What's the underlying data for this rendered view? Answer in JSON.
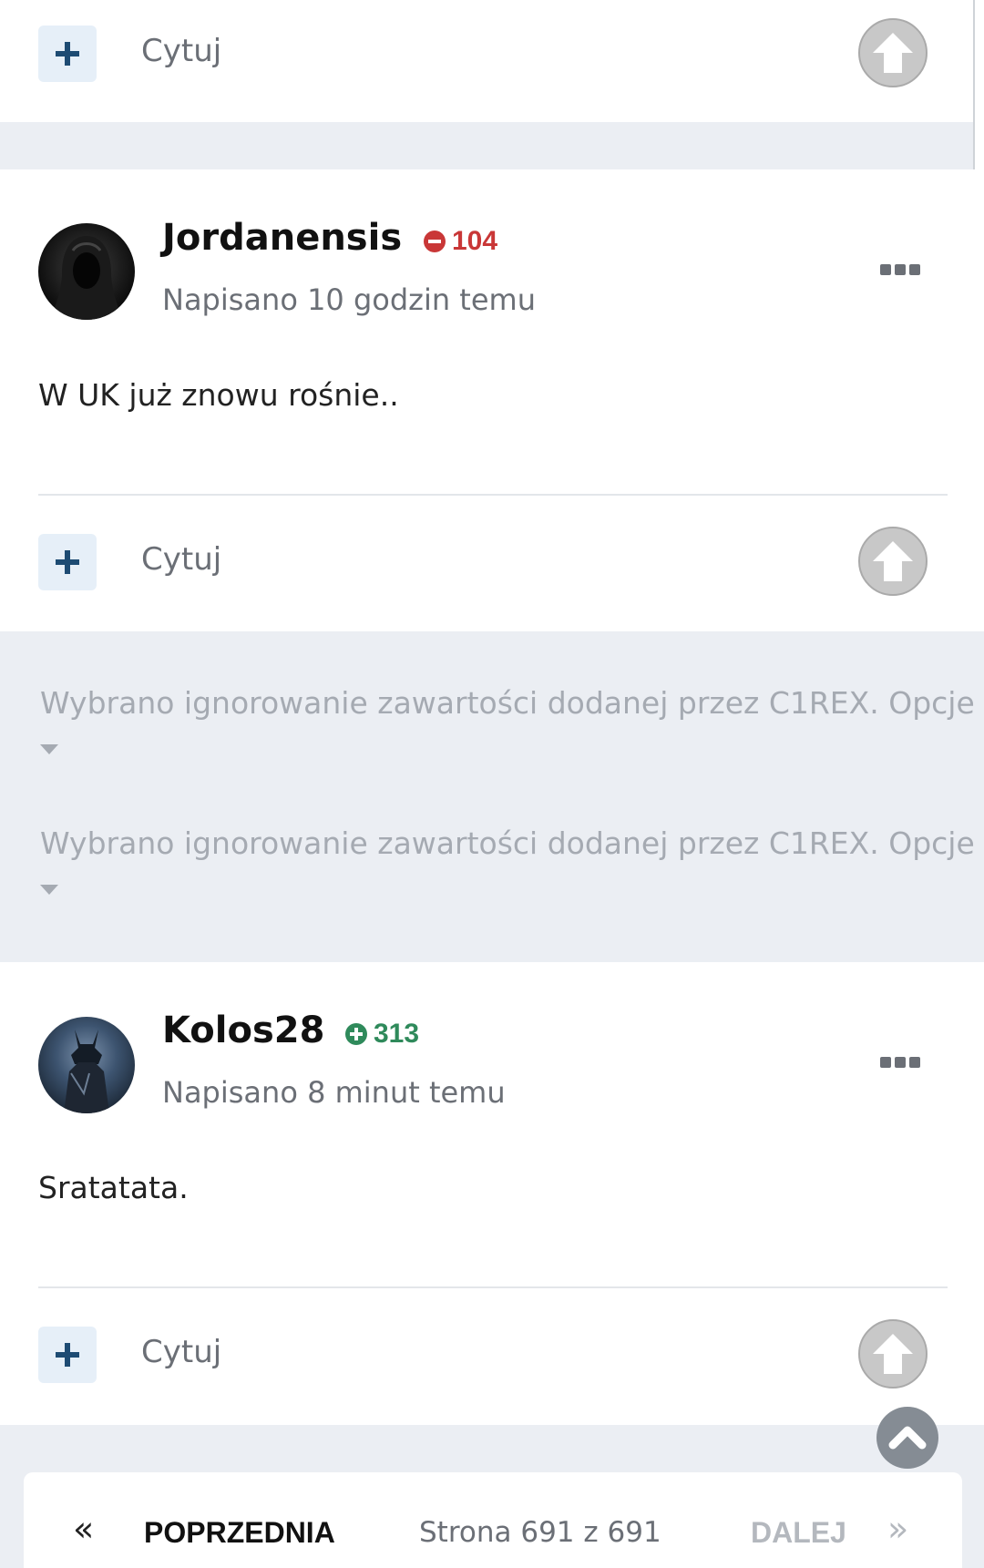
{
  "action_label": "Cytuj",
  "posts": [
    {
      "username": "Jordanensis",
      "reputation": "104",
      "reputation_type": "negative",
      "posted": "Napisano 10 godzin temu",
      "body": "W UK już znowu rośnie.."
    },
    {
      "username": "Kolos28",
      "reputation": "313",
      "reputation_type": "positive",
      "posted": "Napisano 8 minut temu",
      "body": "Sratatata."
    }
  ],
  "ignored": [
    "Wybrano ignorowanie zawartości dodanej przez C1REX. Opcje",
    "Wybrano ignorowanie zawartości dodanej przez C1REX. Opcje"
  ],
  "pagination": {
    "prev_label": "POPRZEDNIA",
    "info": "Strona 691 z 691",
    "next_label": "DALEJ",
    "prev_icon": "«",
    "next_icon": "»"
  },
  "colors": {
    "accent": "#1d4b73",
    "negative": "#c93737",
    "positive": "#2f8a5b",
    "page_bg": "#ebeef3"
  }
}
